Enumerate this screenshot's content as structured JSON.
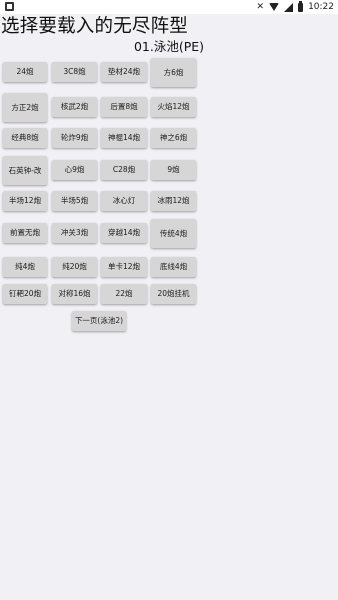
{
  "status_bar": {
    "time": "10:22"
  },
  "header": {
    "title": "选择要载入的无尽阵型",
    "subtitle": "01.泳池(PE)"
  },
  "buttons": [
    "24炮",
    "3C8炮",
    "垫材24炮",
    "方6炮",
    "方正2炮",
    "核武2炮",
    "后置8炮",
    "火焰12炮",
    "经典8炮",
    "轮炸9炮",
    "神棍14炮",
    "神之6炮",
    "石英钟-改",
    "心9炮",
    "C28炮",
    "9炮",
    "半场12炮",
    "半场5炮",
    "冰心灯",
    "冰雨12炮",
    "前置无炮",
    "冲关3炮",
    "穿越14炮",
    "传统4炮",
    "纯4炮",
    "纯20炮",
    "单卡12炮",
    "底线4炮",
    "钉耙20炮",
    "对称16炮",
    "22炮",
    "20炮挂机"
  ],
  "next_page_label": "下一页(泳池2)"
}
